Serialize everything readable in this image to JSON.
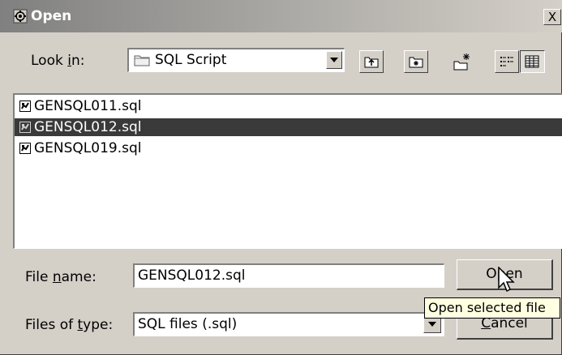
{
  "window": {
    "title": "Open",
    "icon": "open-dialog-icon",
    "close_label": "X"
  },
  "look_in": {
    "label_pre": "Look ",
    "label_mnemonic": "i",
    "label_post": "n:",
    "value": "SQL Script",
    "folder_icon": "folder-icon"
  },
  "toolbar": {
    "buttons": [
      "up-one-level-icon",
      "home-icon",
      "new-folder-icon",
      "list-view-icon",
      "details-view-icon"
    ]
  },
  "files": {
    "items": [
      {
        "name": "GENSQL011.sql",
        "selected": false
      },
      {
        "name": "GENSQL012.sql",
        "selected": true
      },
      {
        "name": "GENSQL019.sql",
        "selected": false
      }
    ]
  },
  "file_name": {
    "label_pre": "File ",
    "label_mnemonic": "n",
    "label_post": "ame:",
    "value": "GENSQL012.sql"
  },
  "file_type": {
    "label_pre": "Files of ",
    "label_mnemonic": "t",
    "label_post": "ype:",
    "value": "SQL files (.sql)"
  },
  "buttons": {
    "open_pre": "O",
    "open_mnemonic": "p",
    "open_post": "en",
    "cancel_mnemonic": "C",
    "cancel_post": "ancel"
  },
  "tooltip": "Open selected file",
  "colors": {
    "selection": "#3a3a3a",
    "titlebar_start": "#808080",
    "dialog_bg": "#d4d0c8",
    "tooltip_bg": "#ffffe1"
  }
}
